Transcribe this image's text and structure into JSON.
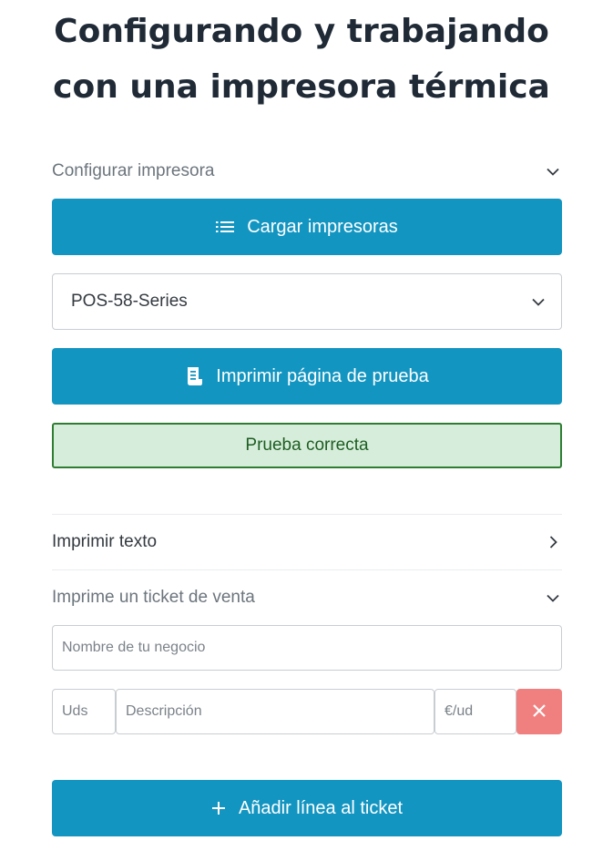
{
  "page": {
    "title_line1": "Configurando y trabajando",
    "title_line2": "con una impresora térmica"
  },
  "configure_section": {
    "header": "Configurar impresora",
    "header_icon": "chevron-down-icon",
    "load_button": {
      "label": "Cargar impresoras",
      "icon": "list-icon"
    },
    "printer_select": {
      "value": "POS-58-Series",
      "icon": "chevron-down-icon"
    },
    "test_button": {
      "label": "Imprimir página de prueba",
      "icon": "receipt-icon"
    },
    "status_alert": "Prueba correcta"
  },
  "print_text_section": {
    "header": "Imprimir texto",
    "header_icon": "chevron-right-icon"
  },
  "ticket_section": {
    "header": "Imprime un ticket de venta",
    "header_icon": "chevron-down-icon",
    "business_name_placeholder": "Nombre de tu negocio",
    "line": {
      "units_placeholder": "Uds",
      "description_placeholder": "Descripción",
      "price_placeholder": "€/ud",
      "delete_icon": "close-icon"
    },
    "add_line_button": {
      "label": "Añadir línea al ticket",
      "icon": "plus-icon"
    }
  },
  "colors": {
    "primary": "#1395c1",
    "success_bg": "#d7eddb",
    "success_border": "#2e7d32",
    "danger": "#f08080"
  }
}
